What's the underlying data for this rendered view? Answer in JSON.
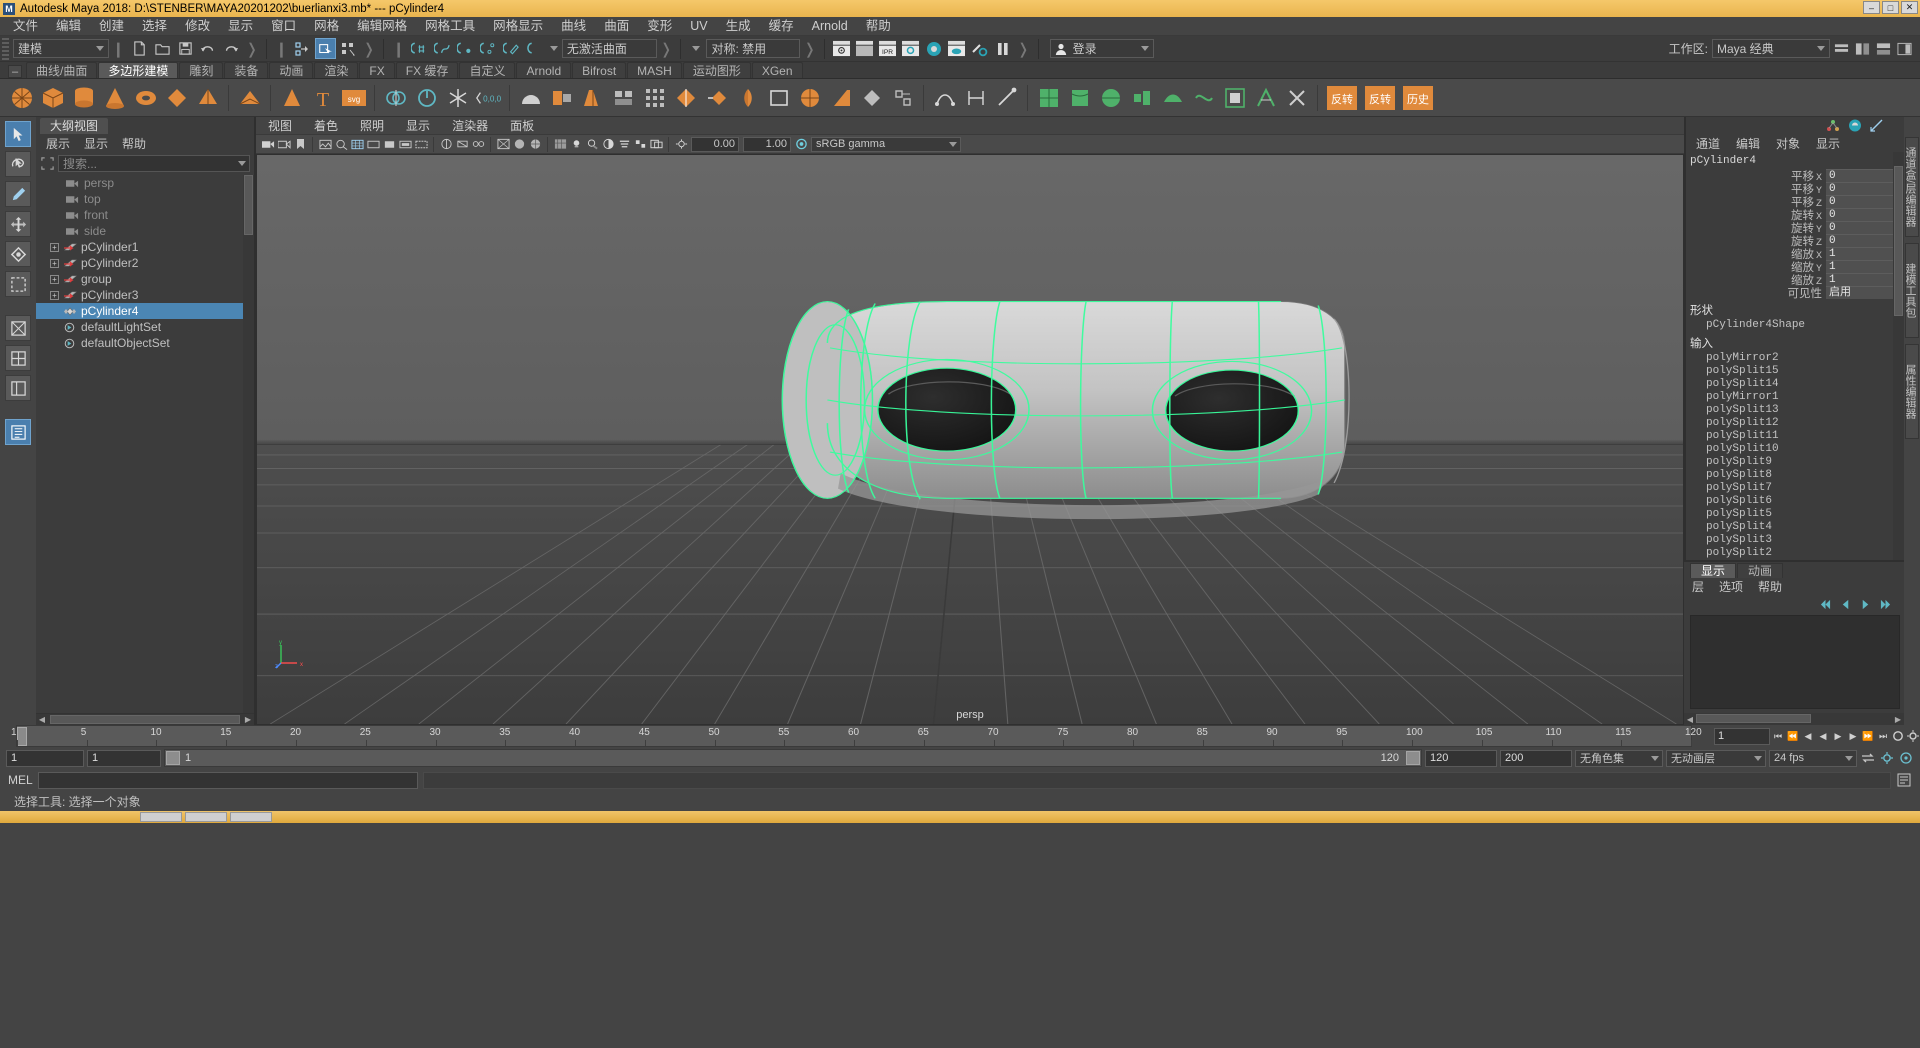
{
  "window": {
    "title": "Autodesk Maya 2018: D:\\STENBER\\MAYA20201202\\buerlianxi3.mb*  ---  pCylinder4",
    "logo": "M",
    "minimize": "–",
    "maximize": "□",
    "close": "✕"
  },
  "menubar": {
    "items": [
      "文件",
      "编辑",
      "创建",
      "选择",
      "修改",
      "显示",
      "窗口",
      "网格",
      "编辑网格",
      "网格工具",
      "网格显示",
      "曲线",
      "曲面",
      "变形",
      "UV",
      "生成",
      "缓存",
      "Arnold",
      "帮助"
    ]
  },
  "statusbar": {
    "mode_menu": "建模",
    "surface_combo": "无激活曲面",
    "symmetry_combo": "对称: 禁用",
    "login_label": "登录",
    "workspace_label": "工作区:",
    "workspace_value": "Maya 经典",
    "ipr_label": "IPR"
  },
  "shelf": {
    "minus": "–",
    "tabs": [
      "曲线/曲面",
      "多边形建模",
      "雕刻",
      "装备",
      "动画",
      "渲染",
      "FX",
      "FX 缓存",
      "自定义",
      "Arnold",
      "Bifrost",
      "MASH",
      "运动图形",
      "XGen"
    ],
    "active_tab": "多边形建模",
    "text_icons": {
      "type": "T",
      "svg": "svg",
      "snap": "0,0,0"
    }
  },
  "outliner": {
    "tab": "大纲视图",
    "menu": [
      "展示",
      "显示",
      "帮助"
    ],
    "search_placeholder": "搜索...",
    "items": [
      {
        "label": "persp",
        "type": "camera",
        "expandable": false,
        "selected": false
      },
      {
        "label": "top",
        "type": "camera",
        "expandable": false,
        "selected": false
      },
      {
        "label": "front",
        "type": "camera",
        "expandable": false,
        "selected": false
      },
      {
        "label": "side",
        "type": "camera",
        "expandable": false,
        "selected": false
      },
      {
        "label": "pCylinder1",
        "type": "transform",
        "expandable": true,
        "selected": false
      },
      {
        "label": "pCylinder2",
        "type": "transform",
        "expandable": true,
        "selected": false
      },
      {
        "label": "group",
        "type": "transform",
        "expandable": true,
        "selected": false
      },
      {
        "label": "pCylinder3",
        "type": "transform",
        "expandable": true,
        "selected": false
      },
      {
        "label": "pCylinder4",
        "type": "mesh",
        "expandable": false,
        "selected": true
      },
      {
        "label": "defaultLightSet",
        "type": "set",
        "expandable": false,
        "selected": false
      },
      {
        "label": "defaultObjectSet",
        "type": "set",
        "expandable": false,
        "selected": false
      }
    ]
  },
  "viewport": {
    "menu": [
      "视图",
      "着色",
      "照明",
      "显示",
      "渲染器",
      "面板"
    ],
    "exposure_value": "0.00",
    "gamma_value": "1.00",
    "colorspace": "sRGB gamma",
    "camera_label": "persp",
    "axis": {
      "x": "x",
      "y": "y",
      "z": "z"
    }
  },
  "channelbox": {
    "menu": [
      "通道",
      "编辑",
      "对象",
      "显示"
    ],
    "node_name": "pCylinder4",
    "attributes": [
      {
        "label": "平移",
        "axis": "X",
        "value": "0"
      },
      {
        "label": "平移",
        "axis": "Y",
        "value": "0"
      },
      {
        "label": "平移",
        "axis": "Z",
        "value": "0"
      },
      {
        "label": "旋转",
        "axis": "X",
        "value": "0"
      },
      {
        "label": "旋转",
        "axis": "Y",
        "value": "0"
      },
      {
        "label": "旋转",
        "axis": "Z",
        "value": "0"
      },
      {
        "label": "缩放",
        "axis": "X",
        "value": "1"
      },
      {
        "label": "缩放",
        "axis": "Y",
        "value": "1"
      },
      {
        "label": "缩放",
        "axis": "Z",
        "value": "1"
      },
      {
        "label": "可见性",
        "axis": "",
        "value": "启用"
      }
    ],
    "shape_section": "形状",
    "shape_node": "pCylinder4Shape",
    "inputs_section": "输入",
    "inputs": [
      "polyMirror2",
      "polySplit15",
      "polySplit14",
      "polyMirror1",
      "polySplit13",
      "polySplit12",
      "polySplit11",
      "polySplit10",
      "polySplit9",
      "polySplit8",
      "polySplit7",
      "polySplit6",
      "polySplit5",
      "polySplit4",
      "polySplit3",
      "polySplit2"
    ]
  },
  "right_tabs": [
    "通道盒/层编辑器",
    "建模工具包",
    "属性编辑器"
  ],
  "layer_editor": {
    "tabs": [
      "显示",
      "动画"
    ],
    "active_tab": "显示",
    "menu": [
      "层",
      "选项",
      "帮助"
    ]
  },
  "timeline": {
    "ticks": [
      "1",
      "5",
      "10",
      "15",
      "20",
      "25",
      "30",
      "35",
      "40",
      "45",
      "50",
      "55",
      "60",
      "65",
      "70",
      "75",
      "80",
      "85",
      "90",
      "95",
      "100",
      "105",
      "110",
      "115",
      "120"
    ],
    "current_frame": "1",
    "playback_buttons": [
      "⏮",
      "⏪",
      "◀",
      "▶",
      "▶",
      "⏩",
      "⏭",
      "⏺"
    ]
  },
  "range": {
    "start": "1",
    "anim_start": "1",
    "slider_start": "1",
    "slider_end": "120",
    "anim_end": "120",
    "end": "200",
    "character_set": "无角色集",
    "anim_layer": "无动画层",
    "fps": "24 fps"
  },
  "mel": {
    "label": "MEL"
  },
  "status": {
    "text": "选择工具: 选择一个对象"
  }
}
